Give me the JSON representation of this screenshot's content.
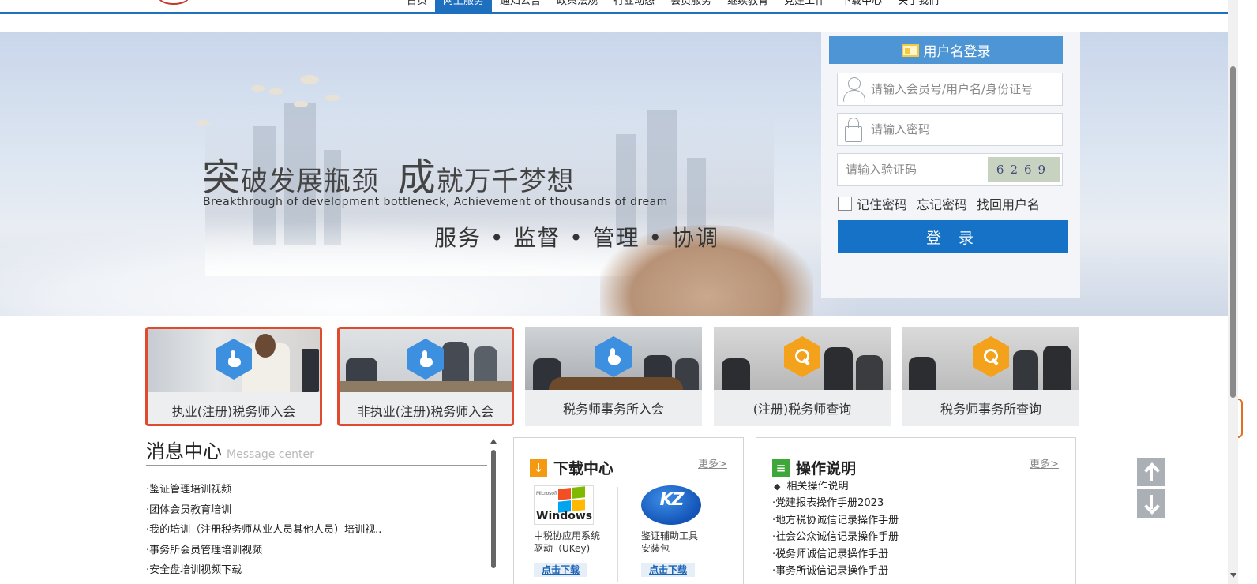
{
  "nav": {
    "items": [
      {
        "label": "首页"
      },
      {
        "label": "网上服务",
        "active": true
      },
      {
        "label": "通知公告"
      },
      {
        "label": "政策法规"
      },
      {
        "label": "行业动态"
      },
      {
        "label": "会员服务"
      },
      {
        "label": "继续教育"
      },
      {
        "label": "党建工作"
      },
      {
        "label": "下载中心"
      },
      {
        "label": "关于我们"
      }
    ]
  },
  "banner": {
    "slogan_char1": "突",
    "slogan_rest1": "破发展瓶颈",
    "slogan_char2": "成",
    "slogan_rest2": "就万千梦想",
    "slogan_en": "Breakthrough of development bottleneck, Achievement of thousands of dream",
    "slogan_values": "服务 • 监督 • 管理 • 协调",
    "slides": 3,
    "active_slide": 1
  },
  "login": {
    "title": "用户名登录",
    "username_placeholder": "请输入会员号/用户名/身份证号",
    "password_placeholder": "请输入密码",
    "captcha_placeholder": "请输入验证码",
    "captcha_code": "6269",
    "remember_label": "记住密码",
    "forgot_password": "忘记密码",
    "find_username": "找回用户名",
    "submit_label": "登 录"
  },
  "tiles": [
    {
      "label": "执业(注册)税务师入会",
      "icon": "hand-pointer-icon",
      "selected": true
    },
    {
      "label": "非执业(注册)税务师入会",
      "icon": "hand-pointer-icon",
      "selected": true
    },
    {
      "label": "税务师事务所入会",
      "icon": "hand-pointer-icon",
      "selected": false
    },
    {
      "label": "(注册)税务师查询",
      "icon": "search-icon",
      "selected": false
    },
    {
      "label": "税务师事务所查询",
      "icon": "search-icon",
      "selected": false
    }
  ],
  "message_center": {
    "title": "消息中心",
    "title_en": "Message center",
    "items": [
      "鉴证管理培训视频",
      "团体会员教育培训",
      "我的培训（注册税务师从业人员其他人员）培训视..",
      "事务所会员管理培训视频",
      "安全盘培训视频下载"
    ]
  },
  "download_center": {
    "title": "下载中心",
    "more": "更多>",
    "items": [
      {
        "name_line1": "中税协应用系统",
        "name_line2": "驱动（UKey)",
        "button": "点击下载",
        "logo_text": "Windows",
        "logo_sub": "Microsoft"
      },
      {
        "name_line1": "鉴证辅助工具",
        "name_line2": "安装包",
        "button": "点击下载"
      }
    ]
  },
  "operations": {
    "title": "操作说明",
    "more": "更多>",
    "subtitle": "相关操作说明",
    "items": [
      "党建报表操作手册2023",
      "地方税协诚信记录操作手册",
      "社会公众诚信记录操作手册",
      "税务师诚信记录操作手册",
      "事务所诚信记录操作手册"
    ]
  },
  "colors": {
    "primary": "#1572c7",
    "nav_active": "#1f6fbf",
    "highlight_border": "#e04a2e",
    "hex_blue": "#3d8fe0",
    "hex_orange": "#f4a21b"
  }
}
